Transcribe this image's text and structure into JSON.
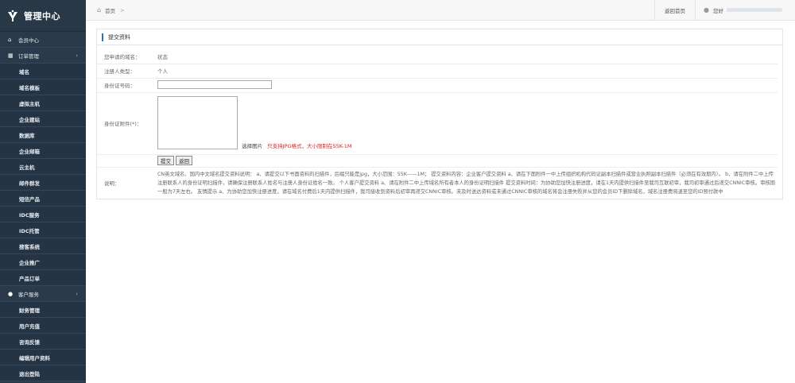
{
  "sidebar": {
    "title": "管理中心",
    "items": [
      {
        "label": "会员中心",
        "icon": "home-icon",
        "type": "group"
      },
      {
        "label": "订单管理",
        "icon": "grid-icon",
        "type": "group",
        "expandable": true
      },
      {
        "label": "域名",
        "type": "sub"
      },
      {
        "label": "域名模板",
        "type": "sub"
      },
      {
        "label": "虚拟主机",
        "type": "sub"
      },
      {
        "label": "企业建站",
        "type": "sub"
      },
      {
        "label": "数据库",
        "type": "sub"
      },
      {
        "label": "企业邮箱",
        "type": "sub"
      },
      {
        "label": "云主机",
        "type": "sub"
      },
      {
        "label": "邮件群发",
        "type": "sub"
      },
      {
        "label": "短信产品",
        "type": "sub"
      },
      {
        "label": "IDC服务",
        "type": "sub"
      },
      {
        "label": "IDC托管",
        "type": "sub"
      },
      {
        "label": "搜客系统",
        "type": "sub"
      },
      {
        "label": "企业推广",
        "type": "sub"
      },
      {
        "label": "产品订单",
        "type": "sub"
      },
      {
        "label": "客户服务",
        "icon": "user-icon",
        "type": "group",
        "expandable": true
      },
      {
        "label": "财务管理",
        "type": "sub"
      },
      {
        "label": "用户充值",
        "type": "sub"
      },
      {
        "label": "咨询反馈",
        "type": "sub"
      },
      {
        "label": "编辑用户资料",
        "type": "sub"
      },
      {
        "label": "退出登陆",
        "type": "sub"
      }
    ]
  },
  "topbar": {
    "breadcrumb": "首页",
    "breadcrumb_sep": ">",
    "back_home": "返回首页",
    "greeting": "您好"
  },
  "panel": {
    "title": "提交资料",
    "rows": {
      "domain_label": "您申请的域名：",
      "domain_value": "状态",
      "registrant_label": "注册人类型：",
      "registrant_value": "个人",
      "idno_label": "身份证号码：",
      "idno_value": "",
      "attach_label": "身份证附件(*)：",
      "select_image": "选择图片",
      "upload_hint": "只支持JPG格式，大小限制在55K-1M",
      "submit": "提交",
      "back": "返回",
      "notes_label": "说明：",
      "notes_text": "CN英文域名、国内中文域名提交资料说明： a、请提交以下书面资料的扫描件，后缀只能是jpg，大小范围：55K——1M； 提交资料内容：企业客户提交资料 a、请在下面附件一中上传组织机构代码证副本扫描件或营业执照副本扫描件（必须在有效期内）。 b、请在附件二中上传注册联系人的身份证明扫描件，请确保注册联系人姓名与注册人身份证姓名一致。 个人客户提交资料 a、请在附件二中上传域名所有者本人的身份证明扫描件 提交资料时间：为协助您加快注册进度，请在1天内提供扫描件至我司互联初审，我司初审通过后递交CNNIC审核。审核期一般为7天左右。 友情提示 a、为协助您加快注册进度，请在域名付费后1天内提供扫描件，我司接收到资料后初审再递交CNNIC审核。未及时送达资料或未通过CNNIC审核的域名将会注册失败并从您的会员ID下删除域名，域名注册费将退至您的ID预付款中"
    }
  },
  "colors": {
    "sidebar_bg": "#2a3a4a",
    "accent": "#3a6ea5",
    "hint_red": "#e02020"
  }
}
